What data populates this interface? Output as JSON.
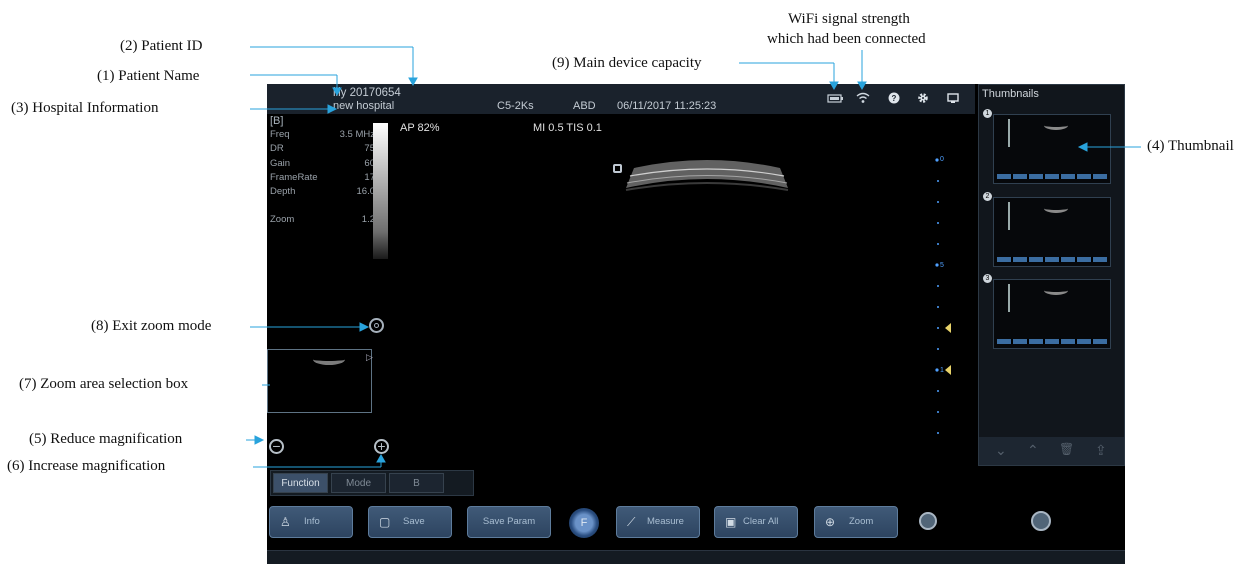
{
  "annotations": {
    "patient_id": "(2) Patient ID",
    "patient_name": "(1) Patient Name",
    "hospital_info": "(3) Hospital Information",
    "device_capacity": "(9) Main device capacity",
    "wifi_line1": "WiFi signal strength",
    "wifi_line2": "which had been connected",
    "thumbnail": "(4) Thumbnail",
    "exit_zoom": "(8) Exit zoom mode",
    "zoom_selection": "(7) Zoom area selection box",
    "reduce_mag": "(5) Reduce magnification",
    "increase_mag": "(6) Increase magnification"
  },
  "header": {
    "patient_name_id": "lily 20170654",
    "hospital": "new hospital",
    "probe": "C5-2Ks",
    "preset": "ABD",
    "datetime": "06/11/2017 11:25:23"
  },
  "imaging": {
    "mode": "[B]",
    "params": [
      {
        "label": "Freq",
        "value": "3.5 MHz"
      },
      {
        "label": "DR",
        "value": "75"
      },
      {
        "label": "Gain",
        "value": "60"
      },
      {
        "label": "FrameRate",
        "value": "17"
      },
      {
        "label": "Depth",
        "value": "16.0"
      },
      {
        "label": "",
        "value": ""
      },
      {
        "label": "Zoom",
        "value": "1.2"
      }
    ],
    "ap": "AP 82%",
    "mi_tis": "MI 0.5 TIS 0.1",
    "depth_marks": [
      "0",
      "5",
      "1"
    ]
  },
  "thumbnails": {
    "title": "Thumbnails",
    "items": [
      "1",
      "2",
      "3"
    ],
    "controls": [
      "⌄",
      "⌃",
      "🗑",
      "⇪"
    ]
  },
  "tabs": [
    "Function",
    "Mode",
    "B"
  ],
  "buttons": {
    "info": "Info",
    "save": "Save",
    "save_param": "Save Param",
    "f": "F",
    "measure": "Measure",
    "clear_all": "Clear All",
    "zoom": "Zoom"
  },
  "colors": {
    "leader": "#29a3dc",
    "background": "#000000",
    "button": "#3b5574"
  }
}
